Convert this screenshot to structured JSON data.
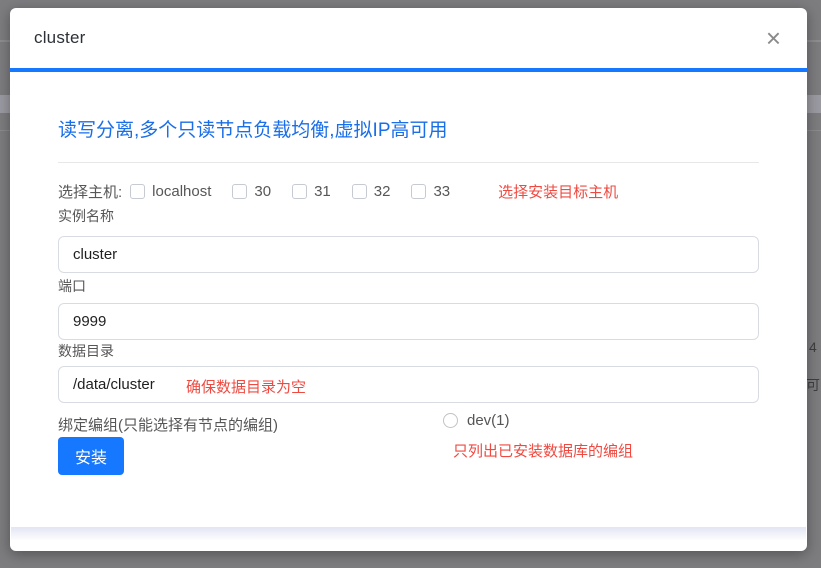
{
  "colors": {
    "accent_blue": "#1677ff",
    "heading_blue": "#1a6ee8",
    "hint_red": "#ef4a41"
  },
  "background_page": {
    "faint_cell_1": "4",
    "faint_cell_2": "可"
  },
  "dialog": {
    "title": "cluster",
    "close_icon": "×",
    "heading": "读写分离,多个只读节点负载均衡,虚拟IP高可用",
    "host_row": {
      "label": "选择主机:",
      "hint": "选择安装目标主机",
      "options": [
        {
          "label": "localhost",
          "checked": false
        },
        {
          "label": "30",
          "checked": false
        },
        {
          "label": "31",
          "checked": false
        },
        {
          "label": "32",
          "checked": false
        },
        {
          "label": "33",
          "checked": false
        }
      ]
    },
    "fields": [
      {
        "label": "实例名称",
        "value": "cluster"
      },
      {
        "label": "端口",
        "value": "9999"
      },
      {
        "label": "数据目录",
        "value": "/data/cluster",
        "hint": "确保数据目录为空"
      }
    ],
    "bind_group": {
      "label": "绑定编组(只能选择有节点的编组)",
      "radio": {
        "label": "dev(1)",
        "checked": false
      },
      "hint": "只列出已安装数据库的编组"
    },
    "install_button": "安装"
  }
}
